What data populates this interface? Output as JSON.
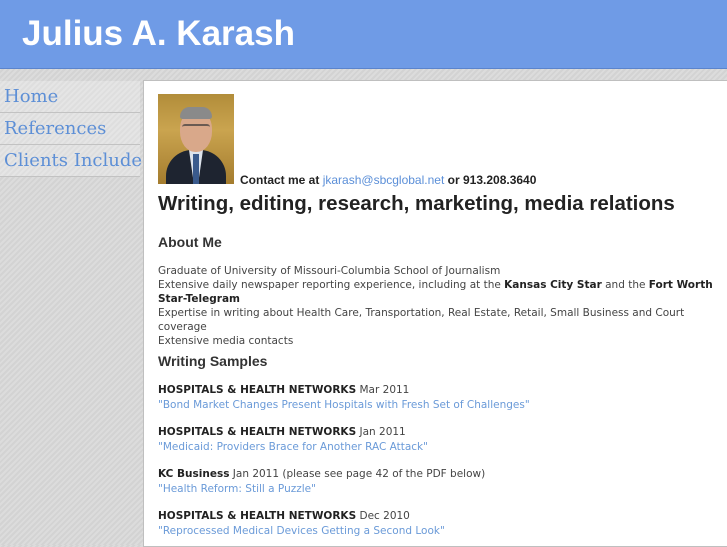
{
  "header": {
    "title": "Julius A. Karash"
  },
  "nav": {
    "items": [
      {
        "label": "Home"
      },
      {
        "label": "References"
      },
      {
        "label": "Clients Include"
      }
    ]
  },
  "contact": {
    "prefix": "Contact me at",
    "email": "jkarash@sbcglobal.net",
    "or": "or",
    "phone": "913.208.3640"
  },
  "headline": "Writing, editing, research, marketing, media relations",
  "about": {
    "heading": "About Me",
    "line1": "Graduate of University of Missouri-Columbia School of Journalism",
    "line2_pre": "Extensive daily newspaper reporting experience, including at the",
    "line2_star": "Kansas City Star",
    "line2_and": "and the",
    "line2_fw": "Fort Worth Star-Telegram",
    "line3": "Expertise in writing about Health Care, Transportation, Real Estate, Retail, Small Business and Court coverage",
    "line4": "Extensive media contacts"
  },
  "samples": {
    "heading": "Writing Samples",
    "items": [
      {
        "pub": "HOSPITALS & HEALTH NETWORKS",
        "date": "Mar 2011",
        "title": "\"Bond Market Changes Present Hospitals with Fresh Set of Challenges\""
      },
      {
        "pub": "HOSPITALS & HEALTH NETWORKS",
        "date": "Jan 2011",
        "title": "\"Medicaid: Providers Brace for Another RAC Attack\""
      },
      {
        "pub": "KC Business",
        "date": "Jan 2011 (please see page 42 of the PDF below)",
        "title": "\"Health Reform: Still a Puzzle\""
      },
      {
        "pub": "HOSPITALS & HEALTH NETWORKS",
        "date": "Dec 2010",
        "title": "\"Reprocessed Medical Devices Getting a Second Look\""
      }
    ]
  }
}
